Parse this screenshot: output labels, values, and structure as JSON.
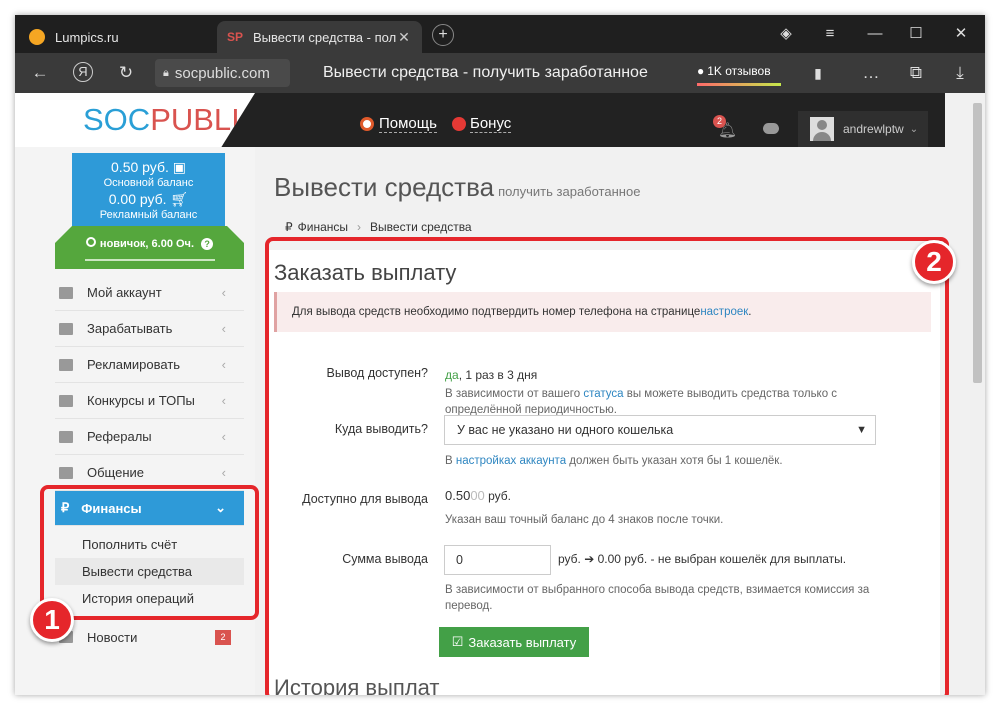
{
  "browser": {
    "tabs": [
      {
        "title": "Lumpics.ru",
        "favicon_color": "#f5a623"
      },
      {
        "title": "Вывести средства - пол",
        "favicon_text": "SP",
        "favicon_color": "#d9534f"
      }
    ],
    "new_tab_icon": "+",
    "address": "socpublic.com",
    "page_title": "Вывести средства - получить заработанное",
    "reviews_label": "1K отзывов"
  },
  "site": {
    "logo_soc": "SOC",
    "logo_public": "PUBLIC",
    "help_label": "Помощь",
    "bonus_label": "Бонус",
    "notifications_count": "2",
    "username": "andrewlptw"
  },
  "sidebar": {
    "main_balance_amount": "0.50 руб.",
    "main_balance_label": "Основной баланс",
    "ad_balance_amount": "0.00 руб.",
    "ad_balance_label": "Рекламный баланс",
    "level": "новичок, 6.00 Оч.",
    "items": [
      {
        "label": "Мой аккаунт",
        "icon": "home-icon"
      },
      {
        "label": "Зарабатывать",
        "icon": "briefcase-icon"
      },
      {
        "label": "Рекламировать",
        "icon": "chart-icon"
      },
      {
        "label": "Конкурсы и ТОПы",
        "icon": "trophy-icon"
      },
      {
        "label": "Рефералы",
        "icon": "users-icon"
      },
      {
        "label": "Общение",
        "icon": "chat-icon"
      }
    ],
    "finance_label": "Финансы",
    "submenu": [
      "Пополнить счёт",
      "Вывести средства",
      "История операций"
    ],
    "news_label": "Новости",
    "news_count": "2"
  },
  "main": {
    "title": "Вывести средства",
    "subtitle": "получить заработанное",
    "breadcrumb": [
      "Финансы",
      "Вывести средства"
    ],
    "panel_title": "Заказать выплату",
    "alert_text": "Для вывода средств необходимо подтвердить номер телефона на странице ",
    "alert_link": "настроек",
    "alert_end": ".",
    "availability_label": "Вывод доступен?",
    "availability_yes": "да",
    "availability_rest": ", 1 раз в 3 дня",
    "availability_note_1": "В зависимости от вашего ",
    "availability_note_link": "статуса",
    "availability_note_2": " вы можете выводить средства только с определённой периодичностью.",
    "wallet_label": "Куда выводить?",
    "wallet_value": "У вас не указано ни одного кошелька",
    "wallet_note_1": "В ",
    "wallet_note_link": "настройках аккаунта",
    "wallet_note_2": " должен быть указан хотя бы 1 кошелёк.",
    "available_label": "Доступно для вывода",
    "available_main": "0.50",
    "available_faded": "00",
    "available_unit": " руб.",
    "available_note": "Указан ваш точный баланс до 4 знаков после точки.",
    "amount_label": "Сумма вывода",
    "amount_value": "0",
    "amount_result_1": "руб. ",
    "amount_result_2": " 0.00 руб. - не выбран кошелёк для выплаты.",
    "amount_note": "В зависимости от выбранного способа вывода средств, взимается комиссия за перевод.",
    "order_button": "Заказать выплату",
    "next_heading": "История выплат"
  },
  "annotations": {
    "marker_1": "1",
    "marker_2": "2",
    "color": "#e5262b"
  }
}
